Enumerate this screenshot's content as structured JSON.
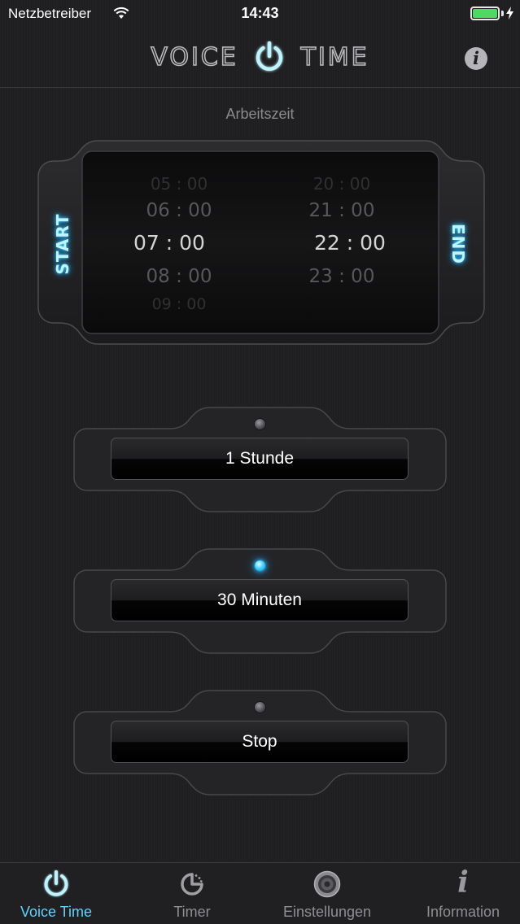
{
  "status_bar": {
    "carrier": "Netzbetreiber",
    "time": "14:43"
  },
  "header": {
    "logo_left": "VOICE",
    "logo_right": "TIME",
    "info_symbol": "i"
  },
  "work_time": {
    "label": "Arbeitszeit",
    "start_label": "START",
    "end_label": "END",
    "start_wheel": [
      "05 : 00",
      "06 : 00",
      "07 : 00",
      "08 : 00",
      "09 : 00"
    ],
    "end_wheel": [
      "20 : 00",
      "21 : 00",
      "22 : 00",
      "23 : 00"
    ],
    "start_selected": "07 : 00",
    "end_selected": "22 : 00"
  },
  "options": [
    {
      "label": "1 Stunde",
      "active": false
    },
    {
      "label": "30 Minuten",
      "active": true
    },
    {
      "label": "Stop",
      "active": false
    }
  ],
  "tab_bar": {
    "tabs": [
      {
        "label": "Voice Time",
        "icon": "power-icon",
        "active": true
      },
      {
        "label": "Timer",
        "icon": "timer-icon",
        "active": false
      },
      {
        "label": "Einstellungen",
        "icon": "speaker-icon",
        "active": false
      },
      {
        "label": "Information",
        "icon": "info-icon",
        "active": false
      }
    ]
  },
  "colors": {
    "accent": "#46d4ff",
    "background": "#1f1f21",
    "battery": "#4cd964"
  }
}
